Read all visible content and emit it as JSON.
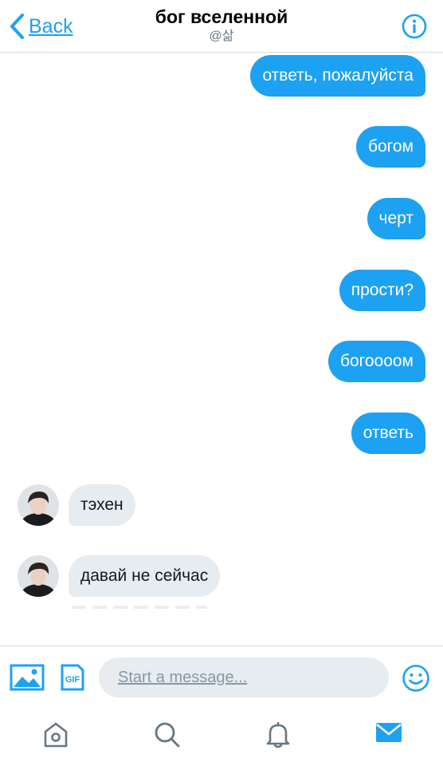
{
  "header": {
    "back_label": "Back",
    "title": "бог вселенной",
    "handle": "@삶"
  },
  "messages": {
    "outgoing": [
      "ответь, пожалуйста",
      "богом",
      "черт",
      "прости?",
      "богоооом",
      "ответь"
    ],
    "incoming": [
      "тэхен",
      "давай не сейчас"
    ]
  },
  "composer": {
    "placeholder": "Start a message...",
    "gif_label": "GIF"
  },
  "icons": {
    "back": "chevron-left-icon",
    "info": "info-icon",
    "media": "image-icon",
    "gif": "gif-icon",
    "emoji": "smiley-icon",
    "home": "home-icon",
    "search": "search-icon",
    "notifications": "bell-icon",
    "messages": "mail-icon"
  },
  "colors": {
    "accent": "#1da1f2",
    "incoming_bubble": "#e6ecf0",
    "icon_gray": "#657786"
  }
}
